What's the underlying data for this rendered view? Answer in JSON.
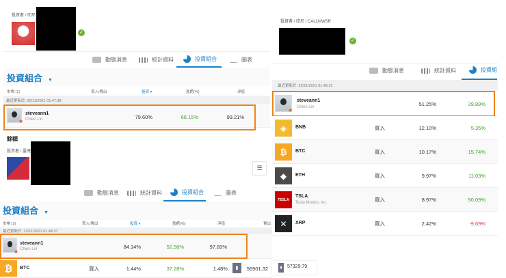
{
  "panel_top_left": {
    "breadcrumb": "投資者 / 印尼",
    "tabs": [
      "動態消息",
      "統計資料",
      "投資組合",
      "圖表"
    ],
    "heading": "投資組合",
    "columns": [
      "市場 (1)",
      "買入/賣出",
      "投資 ▾",
      "盈虧(%)",
      "淨值"
    ],
    "last_updated": "最近更新於: 22/11/2021 01:47:38",
    "row": {
      "username": "steveann1",
      "fullname": "Chien Lin",
      "invested": "79.60%",
      "gain": "66.15%",
      "value": "99.21%"
    }
  },
  "panel_bottom_left": {
    "section_title": "餘額",
    "breadcrumb": "投資者 / 臺灣",
    "tabs": [
      "動態消息",
      "統計資料",
      "投資組合",
      "圖表"
    ],
    "heading": "投資組合",
    "columns": [
      "市場 (2)",
      "買入/賣出",
      "投資 ▾",
      "盈虧(%)",
      "淨值",
      "賣出"
    ],
    "last_updated": "最近更新於: 22/11/2021 01:48:37",
    "row": {
      "username": "steveann1",
      "fullname": "Chien Lin",
      "invested": "84.14%",
      "gain": "52.58%",
      "value": "97.83%"
    },
    "btc_row": {
      "symbol": "BTC",
      "action": "買入",
      "invested": "1.44%",
      "gain": "37.28%",
      "value": "1.48%",
      "sell_price": "56901.32",
      "buy_price": "57329.79"
    }
  },
  "panel_right": {
    "breadcrumb": "投資者 / 印尼 / CALUVWSR",
    "tabs": [
      "動態消息",
      "統計資料",
      "投資組"
    ],
    "last_updated": "最近更新於: 22/11/2021 01:49:21",
    "row": {
      "username": "steveann1",
      "fullname": "Chien Lin",
      "invested": "51.25%",
      "gain": "29.89%"
    },
    "assets": [
      {
        "symbol": "BNB",
        "name": "",
        "action": "買入",
        "invested": "12.10%",
        "gain": "5.35%",
        "icon": "bnb-icon",
        "color": "#f3ba2f",
        "glyph": "◈"
      },
      {
        "symbol": "BTC",
        "name": "",
        "action": "買入",
        "invested": "10.17%",
        "gain": "15.74%",
        "icon": "bitcoin-icon",
        "color": "#f7a823",
        "glyph": "₿"
      },
      {
        "symbol": "ETH",
        "name": "",
        "action": "買入",
        "invested": "9.97%",
        "gain": "11.03%",
        "icon": "ethereum-icon",
        "color": "#4a4a4a",
        "glyph": "◆"
      },
      {
        "symbol": "TSLA",
        "name": "Tesla Motors, Inc.",
        "action": "買入",
        "invested": "8.97%",
        "gain": "50.09%",
        "icon": "tesla-icon",
        "color": "#cc0000",
        "glyph": "TESLA"
      },
      {
        "symbol": "XRP",
        "name": "",
        "action": "買入",
        "invested": "2.42%",
        "gain": "-9.69%",
        "icon": "xrp-icon",
        "color": "#222222",
        "glyph": "✕"
      }
    ]
  },
  "colors": {
    "accent": "#1b7fc4",
    "highlight": "#f08218",
    "positive": "#3ea22b",
    "negative": "#e0383e"
  }
}
